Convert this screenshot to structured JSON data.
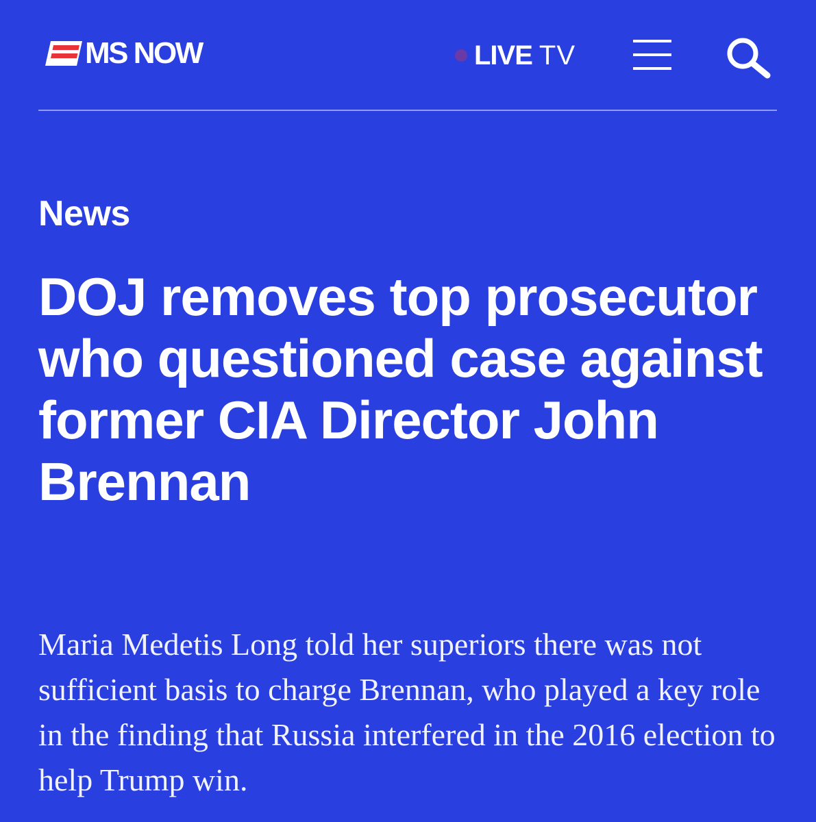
{
  "header": {
    "logo_text": "MS NOW",
    "live_label": "LIVE",
    "tv_label": "TV",
    "icons": {
      "logo": "flag-logo-icon",
      "live": "live-dot-icon",
      "menu": "hamburger-menu-icon",
      "search": "search-icon"
    }
  },
  "article": {
    "category": "News",
    "headline": "DOJ removes top prosecutor who questioned case against former CIA Director John Brennan",
    "dek": "Maria Medetis Long told her superiors there was not sufficient basis to charge Brennan, who played a key role in the finding that Russia interfered in the 2016 election to help Trump win."
  },
  "colors": {
    "background": "#2a3fe0",
    "text": "#ffffff",
    "logo_red": "#e8333a",
    "live_dot": "#6a3aa6",
    "divider": "#8f9cf0"
  }
}
